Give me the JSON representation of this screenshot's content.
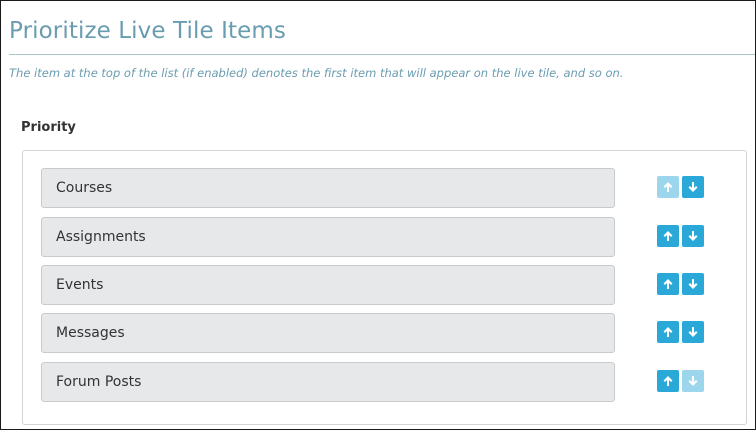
{
  "page": {
    "title": "Prioritize Live Tile Items",
    "description": "The item at the top of the list (if enabled) denotes the first item that will appear on the live tile, and so on."
  },
  "priority": {
    "label": "Priority",
    "items": [
      {
        "label": "Courses",
        "up_enabled": false,
        "down_enabled": true
      },
      {
        "label": "Assignments",
        "up_enabled": true,
        "down_enabled": true
      },
      {
        "label": "Events",
        "up_enabled": true,
        "down_enabled": true
      },
      {
        "label": "Messages",
        "up_enabled": true,
        "down_enabled": true
      },
      {
        "label": "Forum Posts",
        "up_enabled": true,
        "down_enabled": false
      }
    ]
  },
  "colors": {
    "title": "#6a9cb0",
    "button_active": "#2aa9d9",
    "button_disabled": "#9bd6ed",
    "item_background": "#e6e8ea"
  },
  "icons": {
    "move_up": "arrow-up-icon",
    "move_down": "arrow-down-icon"
  }
}
